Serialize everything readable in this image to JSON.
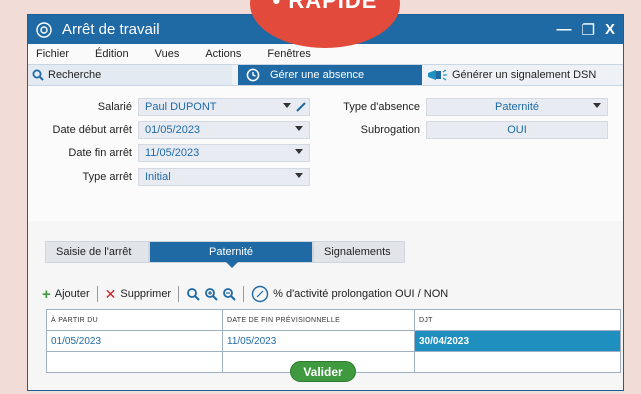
{
  "badge": {
    "text": "• RAPIDE"
  },
  "window": {
    "title": "Arrêt de travail"
  },
  "menu": [
    "Fichier",
    "Édition",
    "Vues",
    "Actions",
    "Fenêtres"
  ],
  "toolbar": {
    "search_label": "Recherche",
    "absence_label": "Gérer une absence",
    "dsn_label": "Générer un signalement DSN"
  },
  "form": {
    "salarie_label": "Salarié",
    "salarie_value": "Paul DUPONT",
    "date_debut_label": "Date début arrêt",
    "date_debut_value": "01/05/2023",
    "date_fin_label": "Date fin arrêt",
    "date_fin_value": "11/05/2023",
    "type_arret_label": "Type arrêt",
    "type_arret_value": "Initial",
    "type_absence_label": "Type d'absence",
    "type_absence_value": "Paternité",
    "subrogation_label": "Subrogation",
    "subrogation_value": "OUI"
  },
  "tabs": [
    "Saisie de l'arrêt",
    "Paternité",
    "Signalements"
  ],
  "actions": {
    "add": "Ajouter",
    "delete": "Supprimer",
    "prolongation": "% d'activité prolongation OUI / NON"
  },
  "grid": {
    "headers": [
      "À PARTIR DU",
      "DATE DE FIN PRÉVISIONNELLE",
      "DJT"
    ],
    "rows": [
      [
        "01/05/2023",
        "11/05/2023",
        "30/04/2023"
      ]
    ]
  },
  "validate_label": "Valider",
  "colors": {
    "primary": "#1f6aa5",
    "accent": "#e24a3c",
    "success": "#3f9a3f"
  }
}
